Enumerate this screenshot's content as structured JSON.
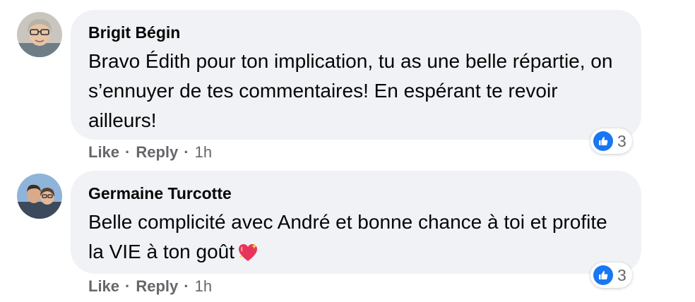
{
  "comments": [
    {
      "author": "Brigit Bégin",
      "text": "Bravo Édith pour ton implication, tu as une belle répartie, on s’ennuyer de tes commentaires! En espérant te revoir ailleurs!",
      "reaction_icon": "like-icon",
      "reaction_count": "3",
      "like_label": "Like",
      "reply_label": "Reply",
      "separator": "·",
      "time": "1h"
    },
    {
      "author": "Germaine Turcotte",
      "text": "Belle complicité avec André et bonne chance à toi et profite la VIE à ton goût",
      "emoji": "sparkling-heart-icon",
      "reaction_icon": "like-icon",
      "reaction_count": "3",
      "like_label": "Like",
      "reply_label": "Reply",
      "separator": "·",
      "time": "1h"
    }
  ],
  "colors": {
    "bubble": "#f0f2f5",
    "like_blue": "#1877f2",
    "secondary_text": "#65676b"
  }
}
